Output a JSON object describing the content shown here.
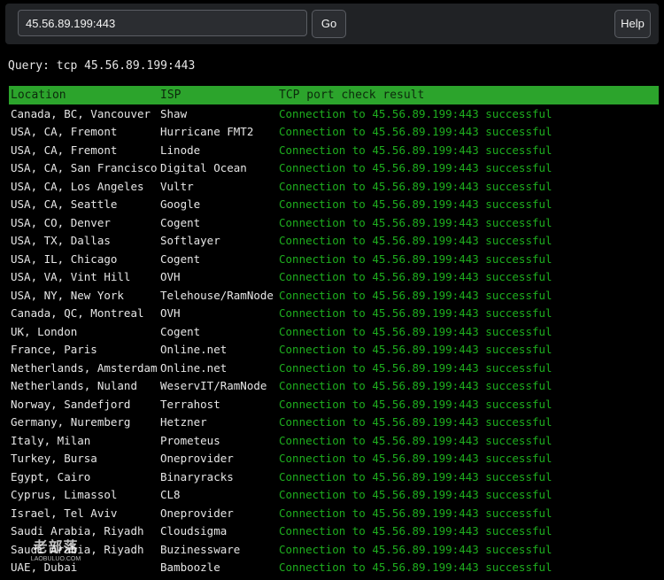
{
  "toolbar": {
    "input_value": "45.56.89.199:443",
    "go_label": "Go",
    "help_label": "Help"
  },
  "query_text": "Query: tcp 45.56.89.199:443",
  "table": {
    "headers": [
      "Location",
      "ISP",
      "TCP port check result"
    ],
    "rows": [
      [
        "Canada, BC, Vancouver",
        "Shaw",
        "Connection to 45.56.89.199:443 successful"
      ],
      [
        "USA, CA, Fremont",
        "Hurricane FMT2",
        "Connection to 45.56.89.199:443 successful"
      ],
      [
        "USA, CA, Fremont",
        "Linode",
        "Connection to 45.56.89.199:443 successful"
      ],
      [
        "USA, CA, San Francisco",
        "Digital Ocean",
        "Connection to 45.56.89.199:443 successful"
      ],
      [
        "USA, CA, Los Angeles",
        "Vultr",
        "Connection to 45.56.89.199:443 successful"
      ],
      [
        "USA, CA, Seattle",
        "Google",
        "Connection to 45.56.89.199:443 successful"
      ],
      [
        "USA, CO, Denver",
        "Cogent",
        "Connection to 45.56.89.199:443 successful"
      ],
      [
        "USA, TX, Dallas",
        "Softlayer",
        "Connection to 45.56.89.199:443 successful"
      ],
      [
        "USA, IL, Chicago",
        "Cogent",
        "Connection to 45.56.89.199:443 successful"
      ],
      [
        "USA, VA, Vint Hill",
        "OVH",
        "Connection to 45.56.89.199:443 successful"
      ],
      [
        "USA, NY, New York",
        "Telehouse/RamNode",
        "Connection to 45.56.89.199:443 successful"
      ],
      [
        "Canada, QC, Montreal",
        "OVH",
        "Connection to 45.56.89.199:443 successful"
      ],
      [
        "UK, London",
        "Cogent",
        "Connection to 45.56.89.199:443 successful"
      ],
      [
        "France, Paris",
        "Online.net",
        "Connection to 45.56.89.199:443 successful"
      ],
      [
        "Netherlands, Amsterdam",
        "Online.net",
        "Connection to 45.56.89.199:443 successful"
      ],
      [
        "Netherlands, Nuland",
        "WeservIT/RamNode",
        "Connection to 45.56.89.199:443 successful"
      ],
      [
        "Norway, Sandefjord",
        "Terrahost",
        "Connection to 45.56.89.199:443 successful"
      ],
      [
        "Germany, Nuremberg",
        "Hetzner",
        "Connection to 45.56.89.199:443 successful"
      ],
      [
        "Italy, Milan",
        "Prometeus",
        "Connection to 45.56.89.199:443 successful"
      ],
      [
        "Turkey, Bursa",
        "Oneprovider",
        "Connection to 45.56.89.199:443 successful"
      ],
      [
        "Egypt, Cairo",
        "Binaryracks",
        "Connection to 45.56.89.199:443 successful"
      ],
      [
        "Cyprus, Limassol",
        "CL8",
        "Connection to 45.56.89.199:443 successful"
      ],
      [
        "Israel, Tel Aviv",
        "Oneprovider",
        "Connection to 45.56.89.199:443 successful"
      ],
      [
        "Saudi Arabia, Riyadh",
        "Cloudsigma",
        "Connection to 45.56.89.199:443 successful"
      ],
      [
        "Saudi Arabia, Riyadh",
        "Buzinessware",
        "Connection to 45.56.89.199:443 successful"
      ],
      [
        "UAE, Dubai",
        "Bamboozle",
        "Connection to 45.56.89.199:443 successful"
      ]
    ]
  },
  "watermark": {
    "mark": "老部落",
    "sub": "LAOBULUO.COM"
  },
  "colors": {
    "header_bg": "#2ca42c",
    "result_text": "#1eae1e",
    "toolbar_bg": "#202225"
  }
}
